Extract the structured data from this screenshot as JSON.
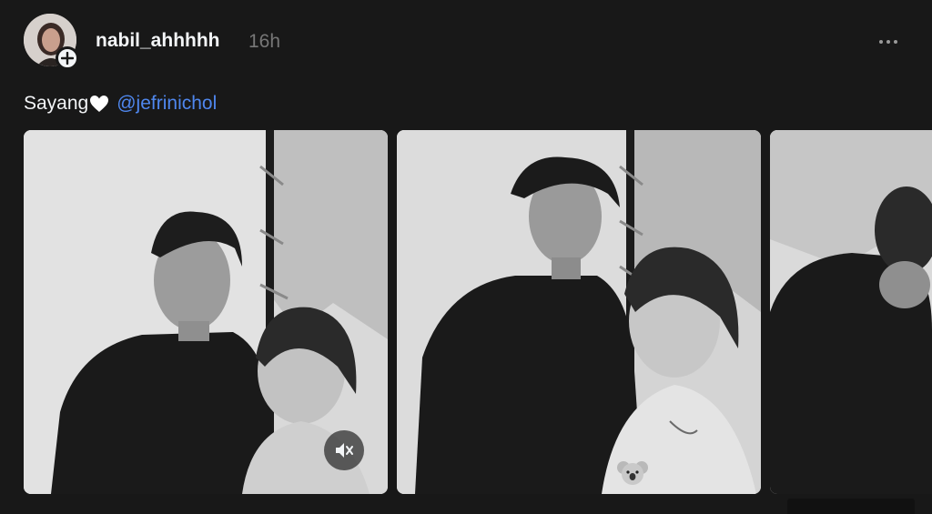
{
  "post": {
    "username": "nabil_ahhhhh",
    "timestamp": "16h",
    "caption": {
      "text": "Sayang",
      "emoji": "white-heart",
      "mention": "@jefrinichol"
    },
    "media": {
      "count_visible": 3,
      "items": [
        {
          "type": "video",
          "muted": true,
          "label": "photo-1"
        },
        {
          "type": "photo",
          "label": "photo-2"
        },
        {
          "type": "photo",
          "label": "photo-3"
        }
      ]
    }
  },
  "icons": {
    "follow": "plus-icon",
    "more": "more-horizontal-icon",
    "mute": "speaker-muted-icon",
    "sticker": "koala-icon",
    "heart": "white-heart-icon"
  },
  "colors": {
    "background": "#181818",
    "text_primary": "#f3f5f7",
    "text_secondary": "#777777",
    "mention": "#4f87ee"
  }
}
